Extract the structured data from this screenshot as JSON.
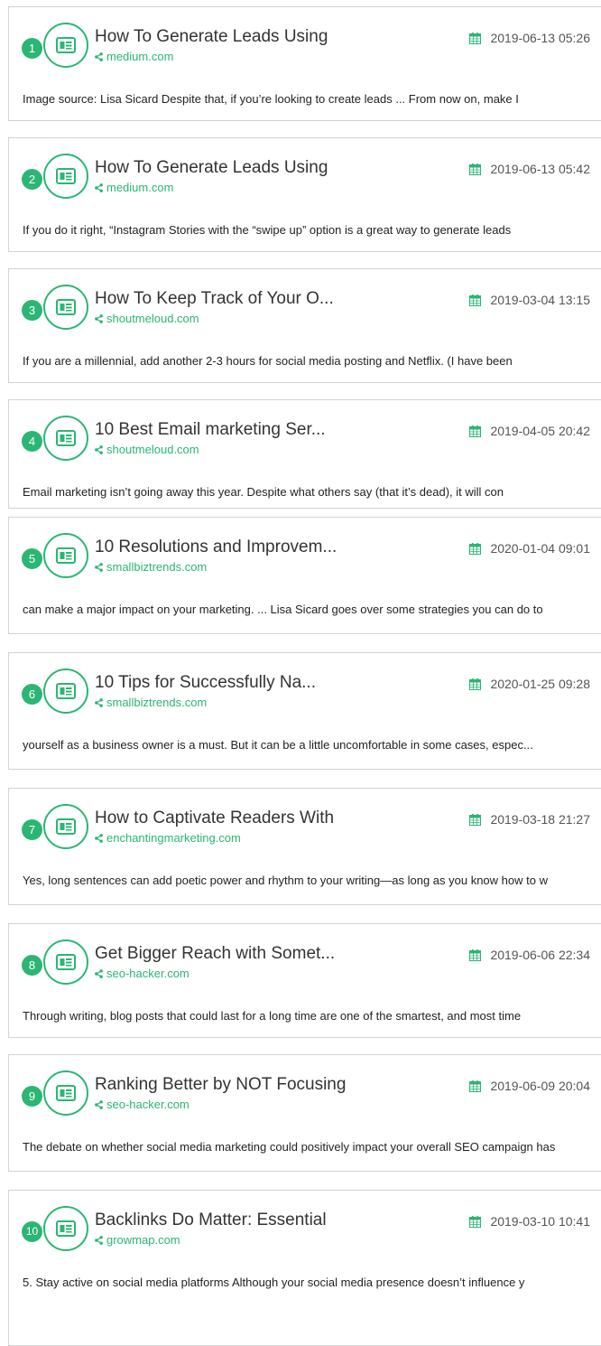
{
  "colors": {
    "accent": "#2bb673",
    "border": "#d3d3d3",
    "text": "#222222"
  },
  "icons": {
    "badge": "newspaper-icon",
    "site": "share-icon",
    "date": "calendar-icon"
  },
  "results": [
    {
      "rank": "1",
      "title": "How To Generate Leads Using",
      "site": "medium.com",
      "date": "2019-06-13 05:26",
      "snippet": "Image source: Lisa Sicard Despite that, if you’re looking to create leads ... From now on, make I"
    },
    {
      "rank": "2",
      "title": "How To Generate Leads Using",
      "site": "medium.com",
      "date": "2019-06-13 05:42",
      "snippet": "If you do it right, “Instagram Stories with the “swipe up” option is a great way to generate leads"
    },
    {
      "rank": "3",
      "title": "How To Keep Track of Your O...",
      "site": "shoutmeloud.com",
      "date": "2019-03-04 13:15",
      "snippet": "If you are a millennial, add another 2-3 hours for social media posting and Netflix. (I have been"
    },
    {
      "rank": "4",
      "title": "10 Best Email marketing Ser...",
      "site": "shoutmeloud.com",
      "date": "2019-04-05 20:42",
      "snippet": "Email marketing isn’t going away this year. Despite what others say (that it’s dead), it will con"
    },
    {
      "rank": "5",
      "title": "10 Resolutions and Improvem...",
      "site": "smallbiztrends.com",
      "date": "2020-01-04 09:01",
      "snippet": "can make a major impact on your marketing. ... Lisa Sicard goes over some strategies you can do to"
    },
    {
      "rank": "6",
      "title": "10 Tips for Successfully Na...",
      "site": "smallbiztrends.com",
      "date": "2020-01-25 09:28",
      "snippet": "yourself as a business owner is a must. But it can be a little uncomfortable in some cases, espec..."
    },
    {
      "rank": "7",
      "title": "How to Captivate Readers With",
      "site": "enchantingmarketing.com",
      "date": "2019-03-18 21:27",
      "snippet": "Yes, long sentences can add poetic power and rhythm to your writing—as long as you know how to w"
    },
    {
      "rank": "8",
      "title": "Get Bigger Reach with Somet...",
      "site": "seo-hacker.com",
      "date": "2019-06-06 22:34",
      "snippet": "Through writing, blog posts that could last for a long time are one of the smartest, and most time"
    },
    {
      "rank": "9",
      "title": "Ranking Better by NOT Focusing",
      "site": "seo-hacker.com",
      "date": "2019-06-09 20:04",
      "snippet": "The debate on whether social media marketing could positively impact your overall SEO campaign has"
    },
    {
      "rank": "10",
      "title": "Backlinks Do Matter: Essential",
      "site": "growmap.com",
      "date": "2019-03-10 10:41",
      "snippet": "5. Stay active on social media platforms Although your social media presence doesn’t influence y"
    }
  ]
}
